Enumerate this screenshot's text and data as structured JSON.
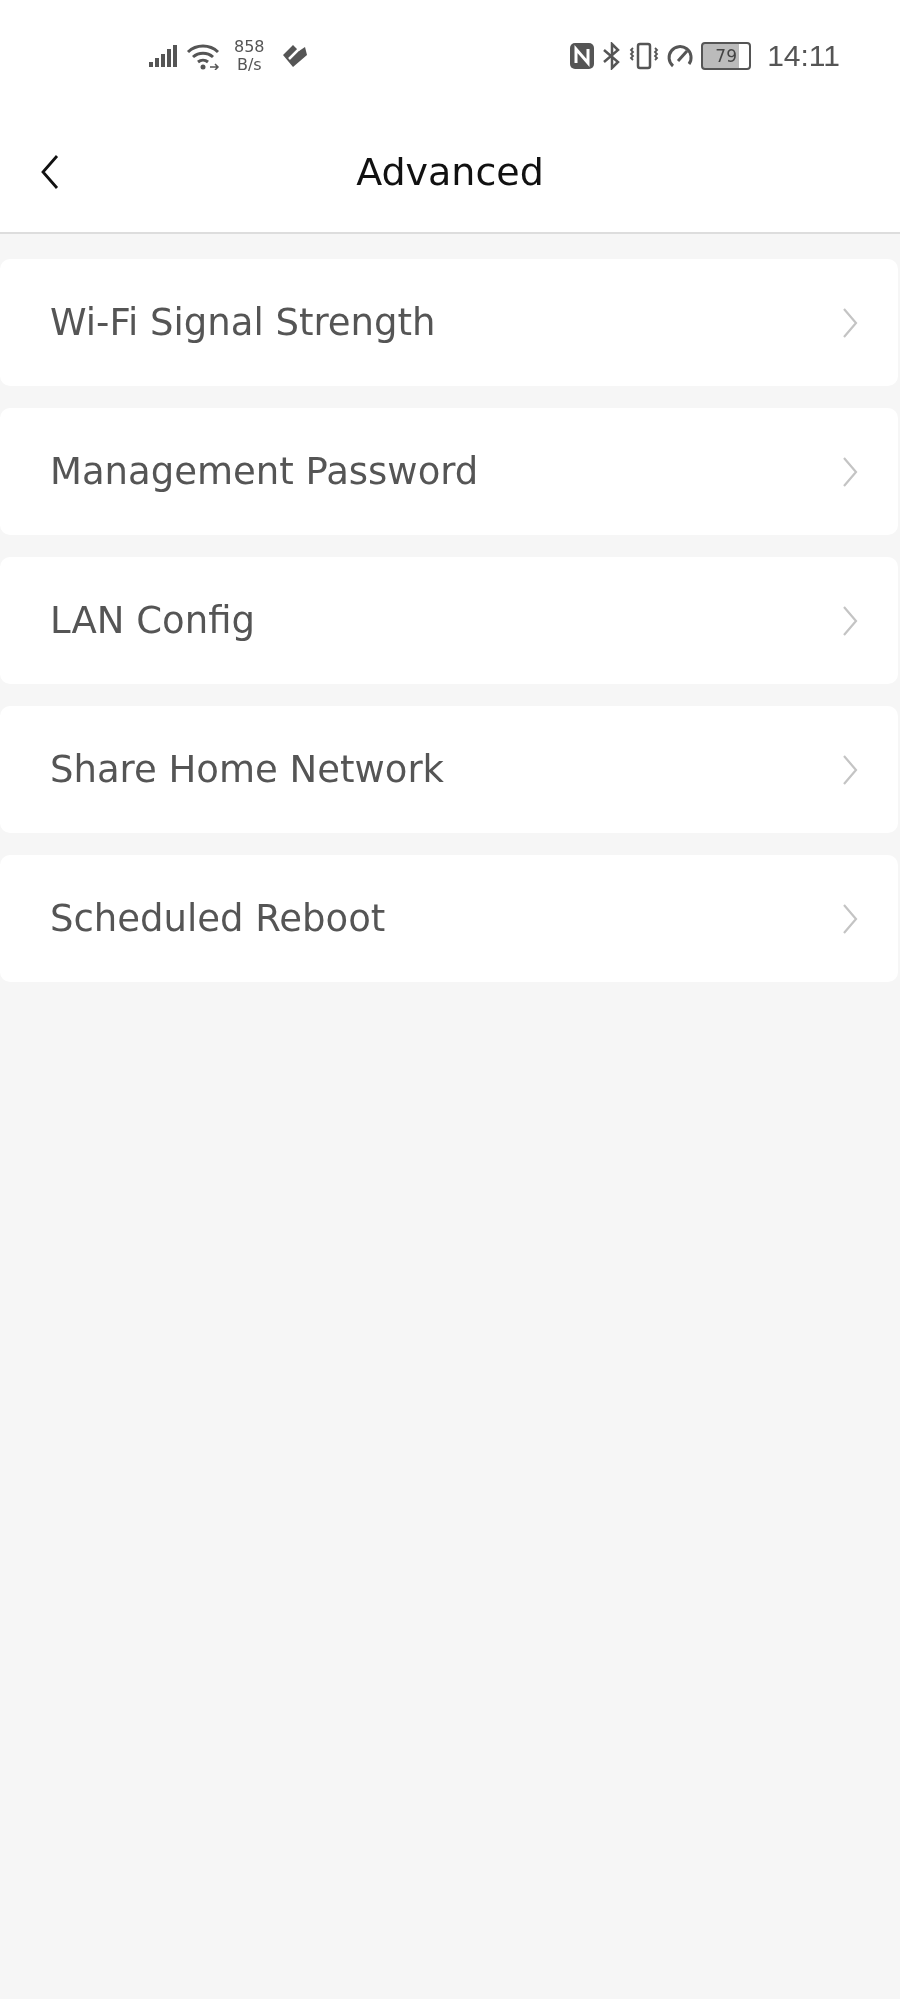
{
  "status_bar": {
    "net_speed": "858",
    "net_unit": "B/s",
    "battery": "79",
    "time": "14:11"
  },
  "header": {
    "title": "Advanced"
  },
  "menu_items": [
    {
      "label": "Wi-Fi Signal Strength"
    },
    {
      "label": "Management Password"
    },
    {
      "label": "LAN Config"
    },
    {
      "label": "Share Home Network"
    },
    {
      "label": "Scheduled Reboot"
    }
  ]
}
